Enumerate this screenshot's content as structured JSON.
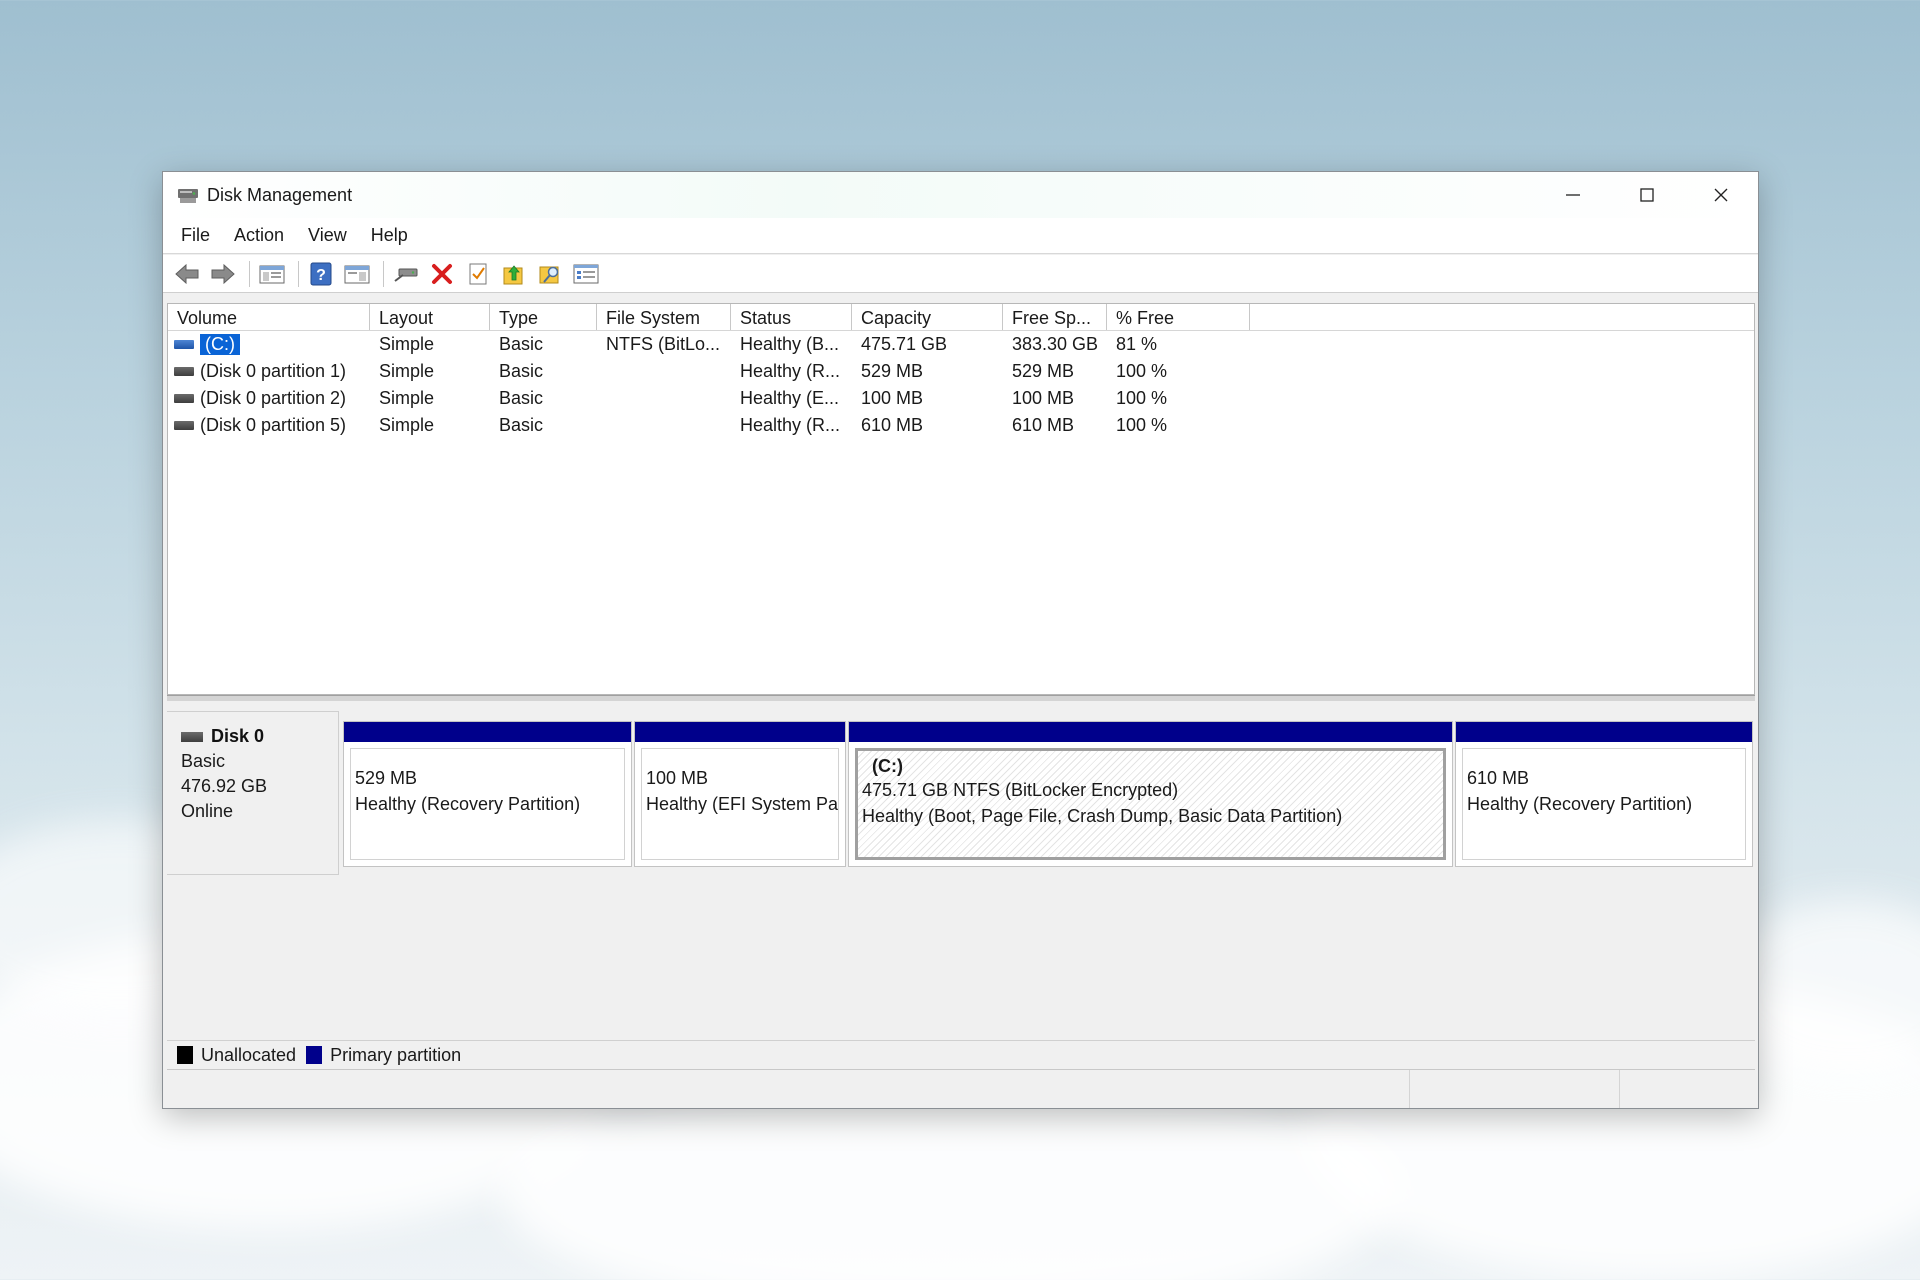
{
  "window": {
    "title": "Disk Management"
  },
  "menu": [
    "File",
    "Action",
    "View",
    "Help"
  ],
  "toolbar_icons": [
    "back-arrow-icon",
    "forward-arrow-icon",
    "console-tree-icon",
    "help-icon",
    "show-hide-pane-icon",
    "connect-icon",
    "delete-icon",
    "check-icon",
    "open-folder-up-icon",
    "folder-search-icon",
    "properties-icon"
  ],
  "table": {
    "columns": [
      "Volume",
      "Layout",
      "Type",
      "File System",
      "Status",
      "Capacity",
      "Free Sp...",
      "% Free"
    ],
    "rows": [
      {
        "volume": "(C:)",
        "layout": "Simple",
        "type": "Basic",
        "fs": "NTFS (BitLo...",
        "status": "Healthy (B...",
        "capacity": "475.71 GB",
        "free": "383.30 GB",
        "pct": "81 %"
      },
      {
        "volume": "(Disk 0 partition 1)",
        "layout": "Simple",
        "type": "Basic",
        "fs": "",
        "status": "Healthy (R...",
        "capacity": "529 MB",
        "free": "529 MB",
        "pct": "100 %"
      },
      {
        "volume": "(Disk 0 partition 2)",
        "layout": "Simple",
        "type": "Basic",
        "fs": "",
        "status": "Healthy (E...",
        "capacity": "100 MB",
        "free": "100 MB",
        "pct": "100 %"
      },
      {
        "volume": "(Disk 0 partition 5)",
        "layout": "Simple",
        "type": "Basic",
        "fs": "",
        "status": "Healthy (R...",
        "capacity": "610 MB",
        "free": "610 MB",
        "pct": "100 %"
      }
    ]
  },
  "disk": {
    "name": "Disk 0",
    "type": "Basic",
    "size": "476.92 GB",
    "state": "Online",
    "partitions": [
      {
        "size": "529 MB",
        "status": "Healthy (Recovery Partition)"
      },
      {
        "size": "100 MB",
        "status": "Healthy (EFI System Pa"
      },
      {
        "name": "(C:)",
        "size": "475.71 GB NTFS (BitLocker Encrypted)",
        "status": "Healthy (Boot, Page File, Crash Dump, Basic Data Partition)"
      },
      {
        "size": "610 MB",
        "status": "Healthy (Recovery Partition)"
      }
    ]
  },
  "legend": [
    {
      "label": "Unallocated",
      "color": "#000000"
    },
    {
      "label": "Primary partition",
      "color": "#00008b"
    }
  ],
  "colors": {
    "primary_partition": "#00008b",
    "selection": "#0a64d6"
  }
}
